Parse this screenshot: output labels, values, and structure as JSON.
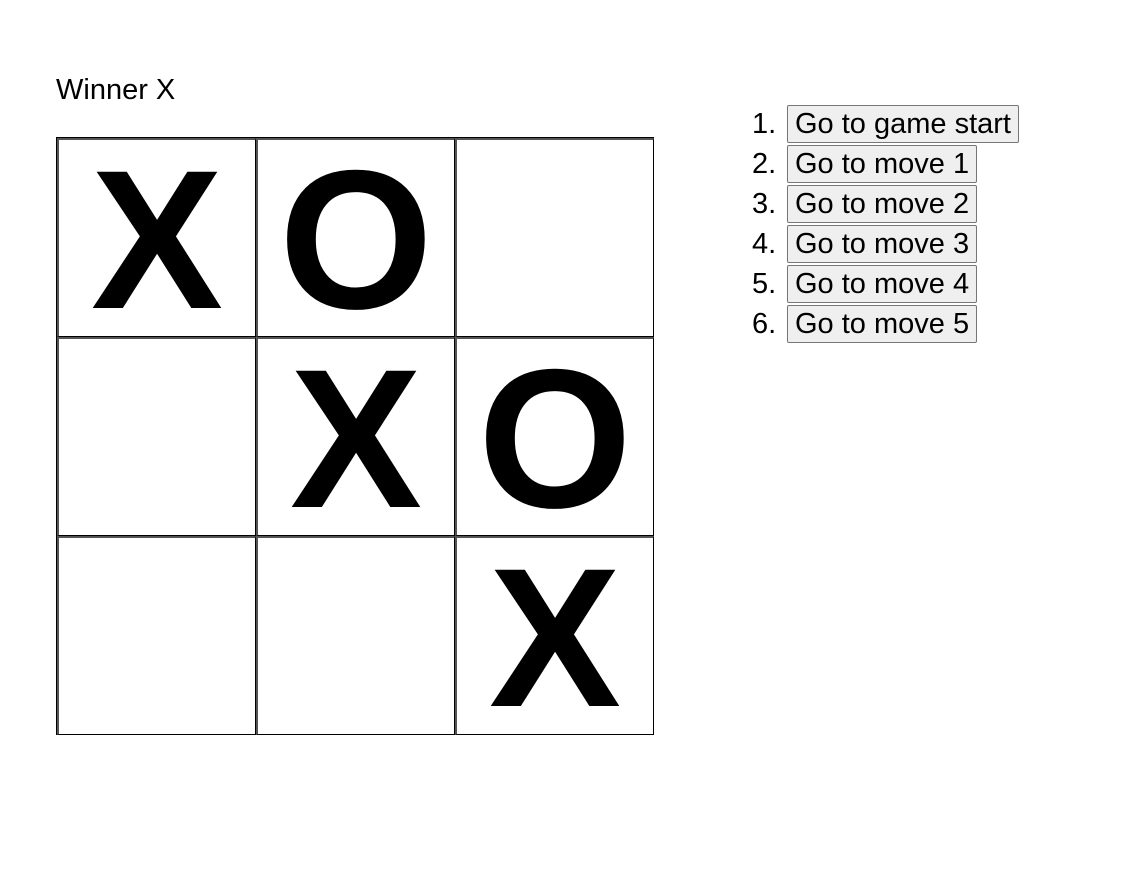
{
  "status": "Winner X",
  "board": {
    "squares": [
      "X",
      "O",
      "",
      "",
      "X",
      "O",
      "",
      "",
      "X"
    ]
  },
  "moves": [
    {
      "number": "1.",
      "label": "Go to game start"
    },
    {
      "number": "2.",
      "label": "Go to move 1"
    },
    {
      "number": "3.",
      "label": "Go to move 2"
    },
    {
      "number": "4.",
      "label": "Go to move 3"
    },
    {
      "number": "5.",
      "label": "Go to move 4"
    },
    {
      "number": "6.",
      "label": "Go to move 5"
    }
  ]
}
